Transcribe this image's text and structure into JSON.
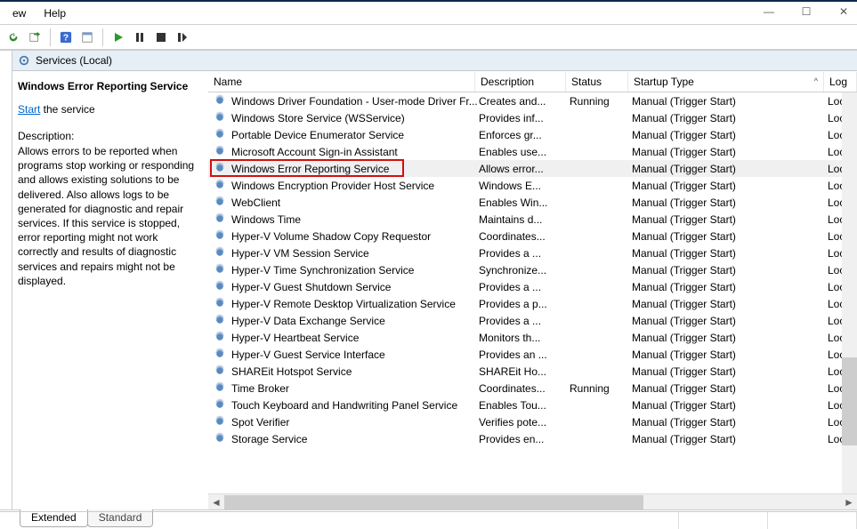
{
  "window": {
    "minimize": "—",
    "maximize": "☐",
    "close": "✕"
  },
  "menu": {
    "view": "ew",
    "help": "Help"
  },
  "toolbar_icons": [
    "refresh",
    "export",
    "help",
    "properties",
    "play",
    "pause",
    "stop",
    "restart"
  ],
  "scope": {
    "label": "Services (Local)"
  },
  "detail": {
    "title": "Windows Error Reporting Service",
    "start_link": "Start",
    "start_suffix": " the service",
    "desc_label": "Description:",
    "desc_text": "Allows errors to be reported when programs stop working or responding and allows existing solutions to be delivered. Also allows logs to be generated for diagnostic and repair services. If this service is stopped, error reporting might not work correctly and results of diagnostic services and repairs might not be displayed."
  },
  "columns": {
    "name": "Name",
    "description": "Description",
    "status": "Status",
    "startup": "Startup Type",
    "logon": "Log"
  },
  "sort_indicator": "^",
  "services": [
    {
      "name": "Windows Driver Foundation - User-mode Driver Fr...",
      "description": "Creates and...",
      "status": "Running",
      "startup": "Manual (Trigger Start)",
      "logon": "Loc"
    },
    {
      "name": "Windows Store Service (WSService)",
      "description": "Provides inf...",
      "status": "",
      "startup": "Manual (Trigger Start)",
      "logon": "Loc"
    },
    {
      "name": "Portable Device Enumerator Service",
      "description": "Enforces gr...",
      "status": "",
      "startup": "Manual (Trigger Start)",
      "logon": "Loc"
    },
    {
      "name": "Microsoft Account Sign-in Assistant",
      "description": "Enables use...",
      "status": "",
      "startup": "Manual (Trigger Start)",
      "logon": "Loc"
    },
    {
      "name": "Windows Error Reporting Service",
      "description": "Allows error...",
      "status": "",
      "startup": "Manual (Trigger Start)",
      "logon": "Loc",
      "highlighted": true,
      "selected": true
    },
    {
      "name": "Windows Encryption Provider Host Service",
      "description": "Windows E...",
      "status": "",
      "startup": "Manual (Trigger Start)",
      "logon": "Loc"
    },
    {
      "name": "WebClient",
      "description": "Enables Win...",
      "status": "",
      "startup": "Manual (Trigger Start)",
      "logon": "Loc"
    },
    {
      "name": "Windows Time",
      "description": "Maintains d...",
      "status": "",
      "startup": "Manual (Trigger Start)",
      "logon": "Loc"
    },
    {
      "name": "Hyper-V Volume Shadow Copy Requestor",
      "description": "Coordinates...",
      "status": "",
      "startup": "Manual (Trigger Start)",
      "logon": "Loc"
    },
    {
      "name": "Hyper-V VM Session Service",
      "description": "Provides a ...",
      "status": "",
      "startup": "Manual (Trigger Start)",
      "logon": "Loc"
    },
    {
      "name": "Hyper-V Time Synchronization Service",
      "description": "Synchronize...",
      "status": "",
      "startup": "Manual (Trigger Start)",
      "logon": "Loc"
    },
    {
      "name": "Hyper-V Guest Shutdown Service",
      "description": "Provides a ...",
      "status": "",
      "startup": "Manual (Trigger Start)",
      "logon": "Loc"
    },
    {
      "name": "Hyper-V Remote Desktop Virtualization Service",
      "description": "Provides a p...",
      "status": "",
      "startup": "Manual (Trigger Start)",
      "logon": "Loc"
    },
    {
      "name": "Hyper-V Data Exchange Service",
      "description": "Provides a ...",
      "status": "",
      "startup": "Manual (Trigger Start)",
      "logon": "Loc"
    },
    {
      "name": "Hyper-V Heartbeat Service",
      "description": "Monitors th...",
      "status": "",
      "startup": "Manual (Trigger Start)",
      "logon": "Loc"
    },
    {
      "name": "Hyper-V Guest Service Interface",
      "description": "Provides an ...",
      "status": "",
      "startup": "Manual (Trigger Start)",
      "logon": "Loc"
    },
    {
      "name": "SHAREit Hotspot Service",
      "description": "SHAREit Ho...",
      "status": "",
      "startup": "Manual (Trigger Start)",
      "logon": "Loc"
    },
    {
      "name": "Time Broker",
      "description": "Coordinates...",
      "status": "Running",
      "startup": "Manual (Trigger Start)",
      "logon": "Loc"
    },
    {
      "name": "Touch Keyboard and Handwriting Panel Service",
      "description": "Enables Tou...",
      "status": "",
      "startup": "Manual (Trigger Start)",
      "logon": "Loc"
    },
    {
      "name": "Spot Verifier",
      "description": "Verifies pote...",
      "status": "",
      "startup": "Manual (Trigger Start)",
      "logon": "Loc"
    },
    {
      "name": "Storage Service",
      "description": "Provides en...",
      "status": "",
      "startup": "Manual (Trigger Start)",
      "logon": "Loc"
    }
  ],
  "tabs": {
    "extended": "Extended",
    "standard": "Standard"
  }
}
